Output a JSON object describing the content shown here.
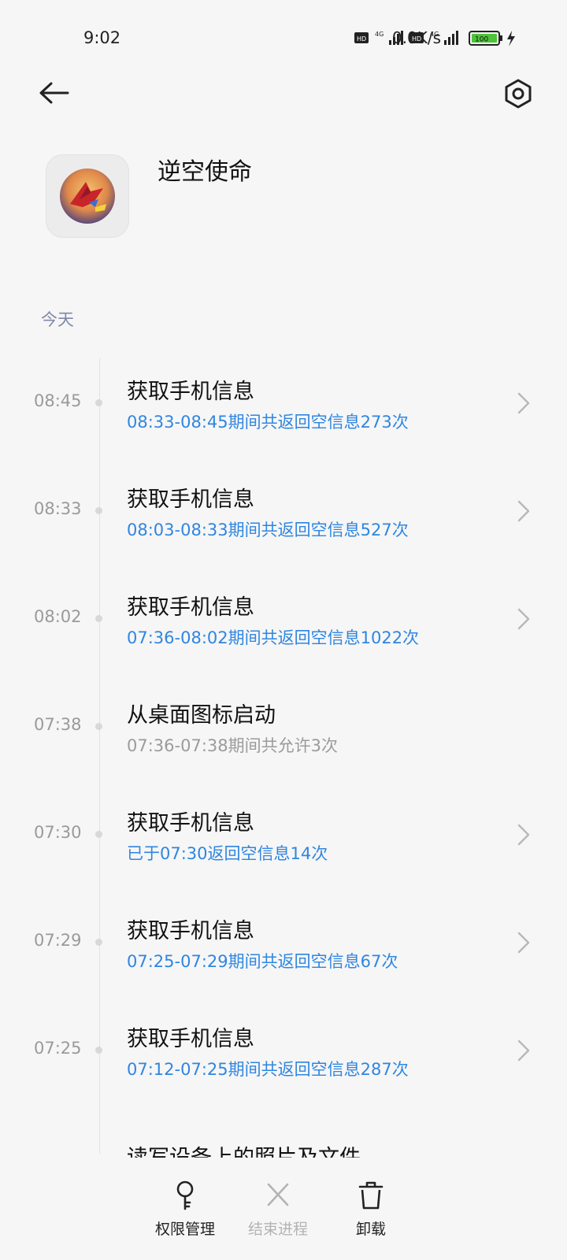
{
  "status_bar": {
    "time": "9:02",
    "net_speed": "0.0K/s",
    "battery": "100"
  },
  "header": {
    "back_icon": "back-arrow-icon",
    "settings_icon": "settings-hex-icon"
  },
  "app": {
    "name": "逆空使命"
  },
  "section": {
    "label": "今天"
  },
  "records": [
    {
      "time": "08:45",
      "title": "获取手机信息",
      "detail": "08:33-08:45期间共返回空信息273次",
      "detail_color": "#2f86e0",
      "has_chevron": true
    },
    {
      "time": "08:33",
      "title": "获取手机信息",
      "detail": "08:03-08:33期间共返回空信息527次",
      "detail_color": "#2f86e0",
      "has_chevron": true
    },
    {
      "time": "08:02",
      "title": "获取手机信息",
      "detail": "07:36-08:02期间共返回空信息1022次",
      "detail_color": "#2f86e0",
      "has_chevron": true
    },
    {
      "time": "07:38",
      "title": "从桌面图标启动",
      "detail": "07:36-07:38期间共允许3次",
      "detail_color": "#9b9b9b",
      "has_chevron": false
    },
    {
      "time": "07:30",
      "title": "获取手机信息",
      "detail": "已于07:30返回空信息14次",
      "detail_color": "#2f86e0",
      "has_chevron": true
    },
    {
      "time": "07:29",
      "title": "获取手机信息",
      "detail": "07:25-07:29期间共返回空信息67次",
      "detail_color": "#2f86e0",
      "has_chevron": true
    },
    {
      "time": "07:25",
      "title": "获取手机信息",
      "detail": "07:12-07:25期间共返回空信息287次",
      "detail_color": "#2f86e0",
      "has_chevron": true
    }
  ],
  "partial_record": {
    "title": "读写设备上的照片及文件"
  },
  "bottom_actions": {
    "permissions": "权限管理",
    "end_process": "结束进程",
    "uninstall": "卸载"
  },
  "colors": {
    "accent": "#2f86e0",
    "background": "#f6f6f6"
  }
}
